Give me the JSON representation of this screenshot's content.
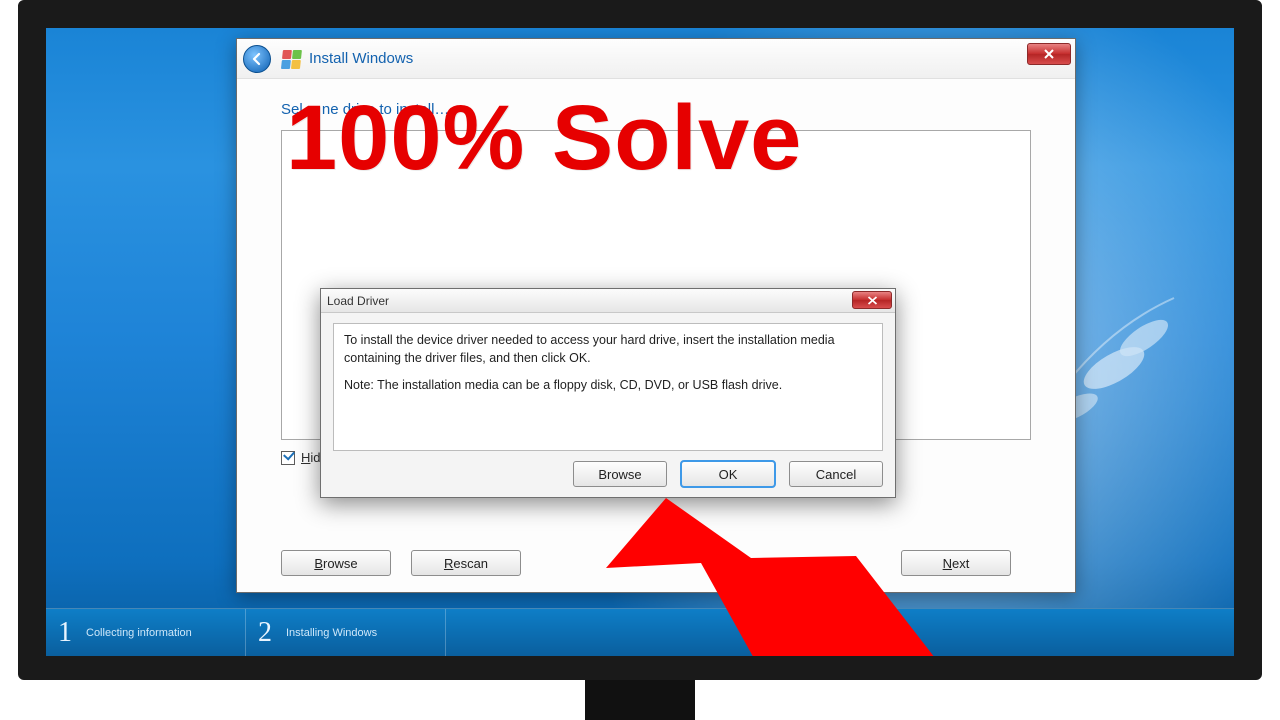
{
  "overlay": {
    "headline": "100% Solve"
  },
  "installer": {
    "title": "Install Windows",
    "heading_partial": "Sel… ne drive to install…",
    "hide_checkbox_label_prefix": "H",
    "hide_checkbox_label_rest": "ide dri",
    "buttons": {
      "browse": "Browse",
      "rescan": "Rescan",
      "next": "Next"
    }
  },
  "dialog": {
    "title": "Load Driver",
    "body_line1": "To install the device driver needed to access your hard drive, insert the installation media containing the driver files, and then click OK.",
    "body_line2": "Note: The installation media can be a floppy disk, CD, DVD, or USB flash drive.",
    "buttons": {
      "browse": "Browse",
      "ok": "OK",
      "cancel": "Cancel"
    }
  },
  "steps": {
    "step1_num": "1",
    "step1_label": "Collecting information",
    "step2_num": "2",
    "step2_label": "Installing Windows"
  }
}
